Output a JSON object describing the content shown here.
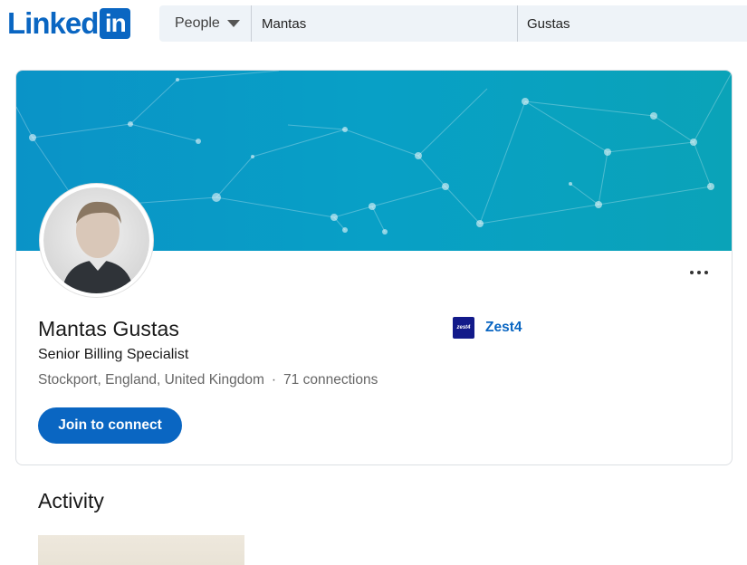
{
  "header": {
    "logo_text": "Linked",
    "logo_box_text": "in",
    "search": {
      "type_label": "People",
      "first_name": "Mantas",
      "last_name": "Gustas"
    }
  },
  "profile": {
    "name": "Mantas Gustas",
    "headline": "Senior Billing Specialist",
    "location": "Stockport, England, United Kingdom",
    "separator": "·",
    "connections": "71 connections",
    "join_button": "Join to connect",
    "company": {
      "name": "Zest4",
      "logo_text": "zest4"
    },
    "more_icon": "more-horizontal-icon"
  },
  "activity": {
    "title": "Activity"
  },
  "colors": {
    "brand": "#0a66c2",
    "banner": "#0a93c7",
    "company_logo": "#121a8a"
  }
}
